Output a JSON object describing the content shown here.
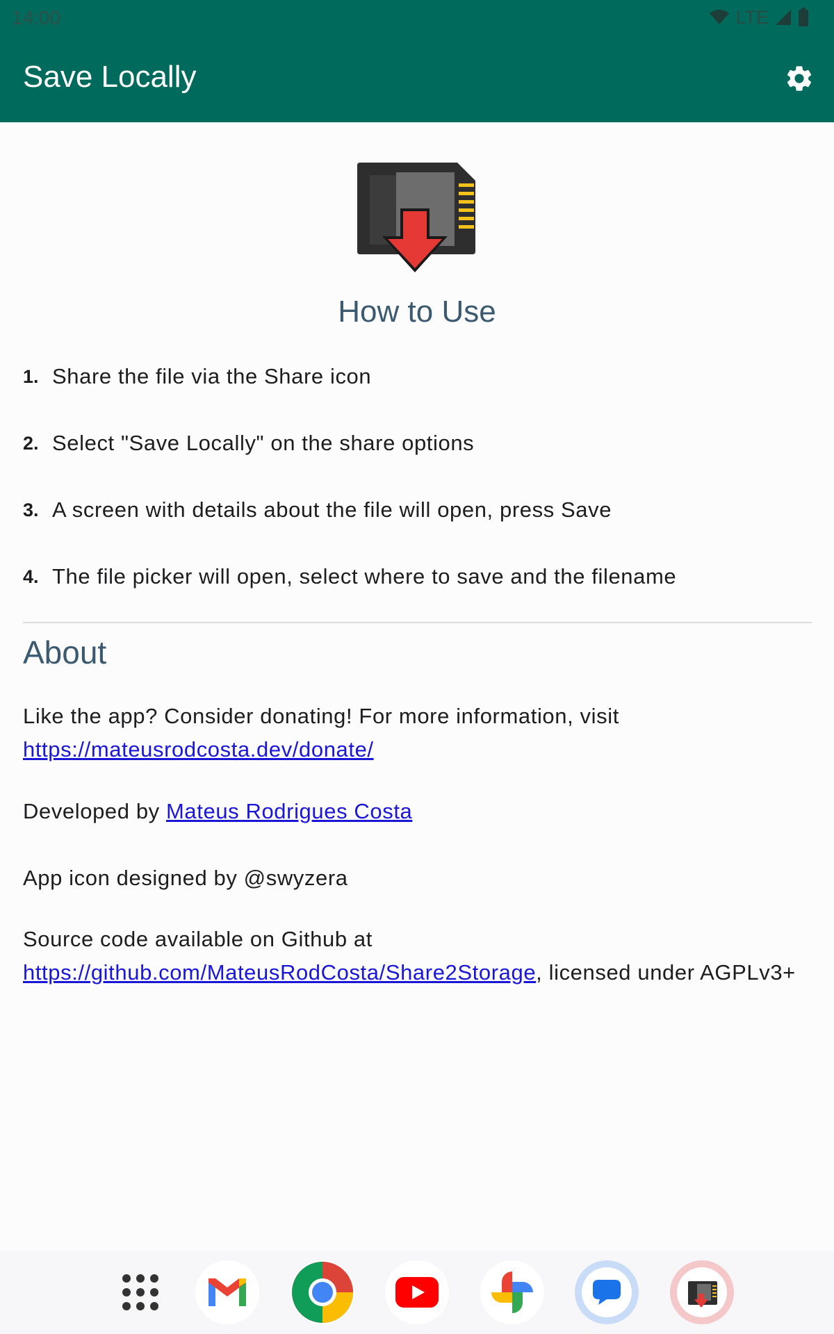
{
  "status": {
    "time": "14:00",
    "network": "LTE"
  },
  "app_bar": {
    "title": "Save Locally",
    "settings_icon": "gear-icon"
  },
  "how_to_use": {
    "title": "How to Use",
    "steps": [
      {
        "num": "1.",
        "text": "Share the file via the Share icon"
      },
      {
        "num": "2.",
        "text": "Select \"Save Locally\" on the share options"
      },
      {
        "num": "3.",
        "text": "A screen with details about the file will open, press Save"
      },
      {
        "num": "4.",
        "text": "The file picker will open, select where to save and the filename"
      }
    ]
  },
  "about": {
    "title": "About",
    "donate_text": "Like the app? Consider donating! For more information, visit",
    "donate_link": "https://mateusrodcosta.dev/donate/",
    "developed_by": "Developed by",
    "developer_name": "Mateus Rodrigues Costa",
    "icon_credit": "App icon designed by @swyzera",
    "source_text": "Source code available on Github at",
    "source_link": "https://github.com/MateusRodCosta/Share2Storage",
    "license_text": ", licensed under AGPLv3+"
  },
  "dock": {
    "items": [
      "app-drawer-icon",
      "gmail-icon",
      "chrome-icon",
      "youtube-icon",
      "photos-icon",
      "messages-icon",
      "save-locally-icon"
    ]
  },
  "colors": {
    "primary": "#006b5c",
    "heading": "#3b5a70",
    "link": "#1a16d8",
    "arrow_red": "#e53935"
  }
}
